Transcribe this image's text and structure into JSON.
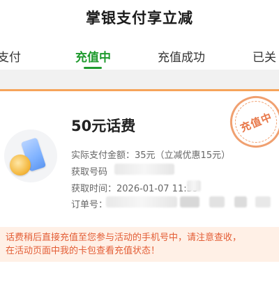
{
  "header": {
    "title": "掌银支付享立减"
  },
  "tabs": [
    {
      "label": "支付",
      "active": false
    },
    {
      "label": "充值中",
      "active": true
    },
    {
      "label": "充值成功",
      "active": false
    },
    {
      "label": "已关",
      "active": false
    }
  ],
  "order": {
    "product_name": "50元话费",
    "paid_line": "实际支付金额：35元（立减优惠15元）",
    "account_label": "获取号码",
    "time_line": "获取时间：2026-01-07 11:35",
    "order_no_label": "订单号：",
    "stamp_text": "充值中"
  },
  "notice": {
    "line1": "话费稍后直接充值至您参与活动的手机号中，请注意查收，",
    "line2": "在活动页面中我的卡包查看充值状态！"
  },
  "colors": {
    "accent_green": "#1f9a2e",
    "card_border": "#f6a45a",
    "notice_text": "#e35d35",
    "notice_bg": "#fff0e6"
  }
}
